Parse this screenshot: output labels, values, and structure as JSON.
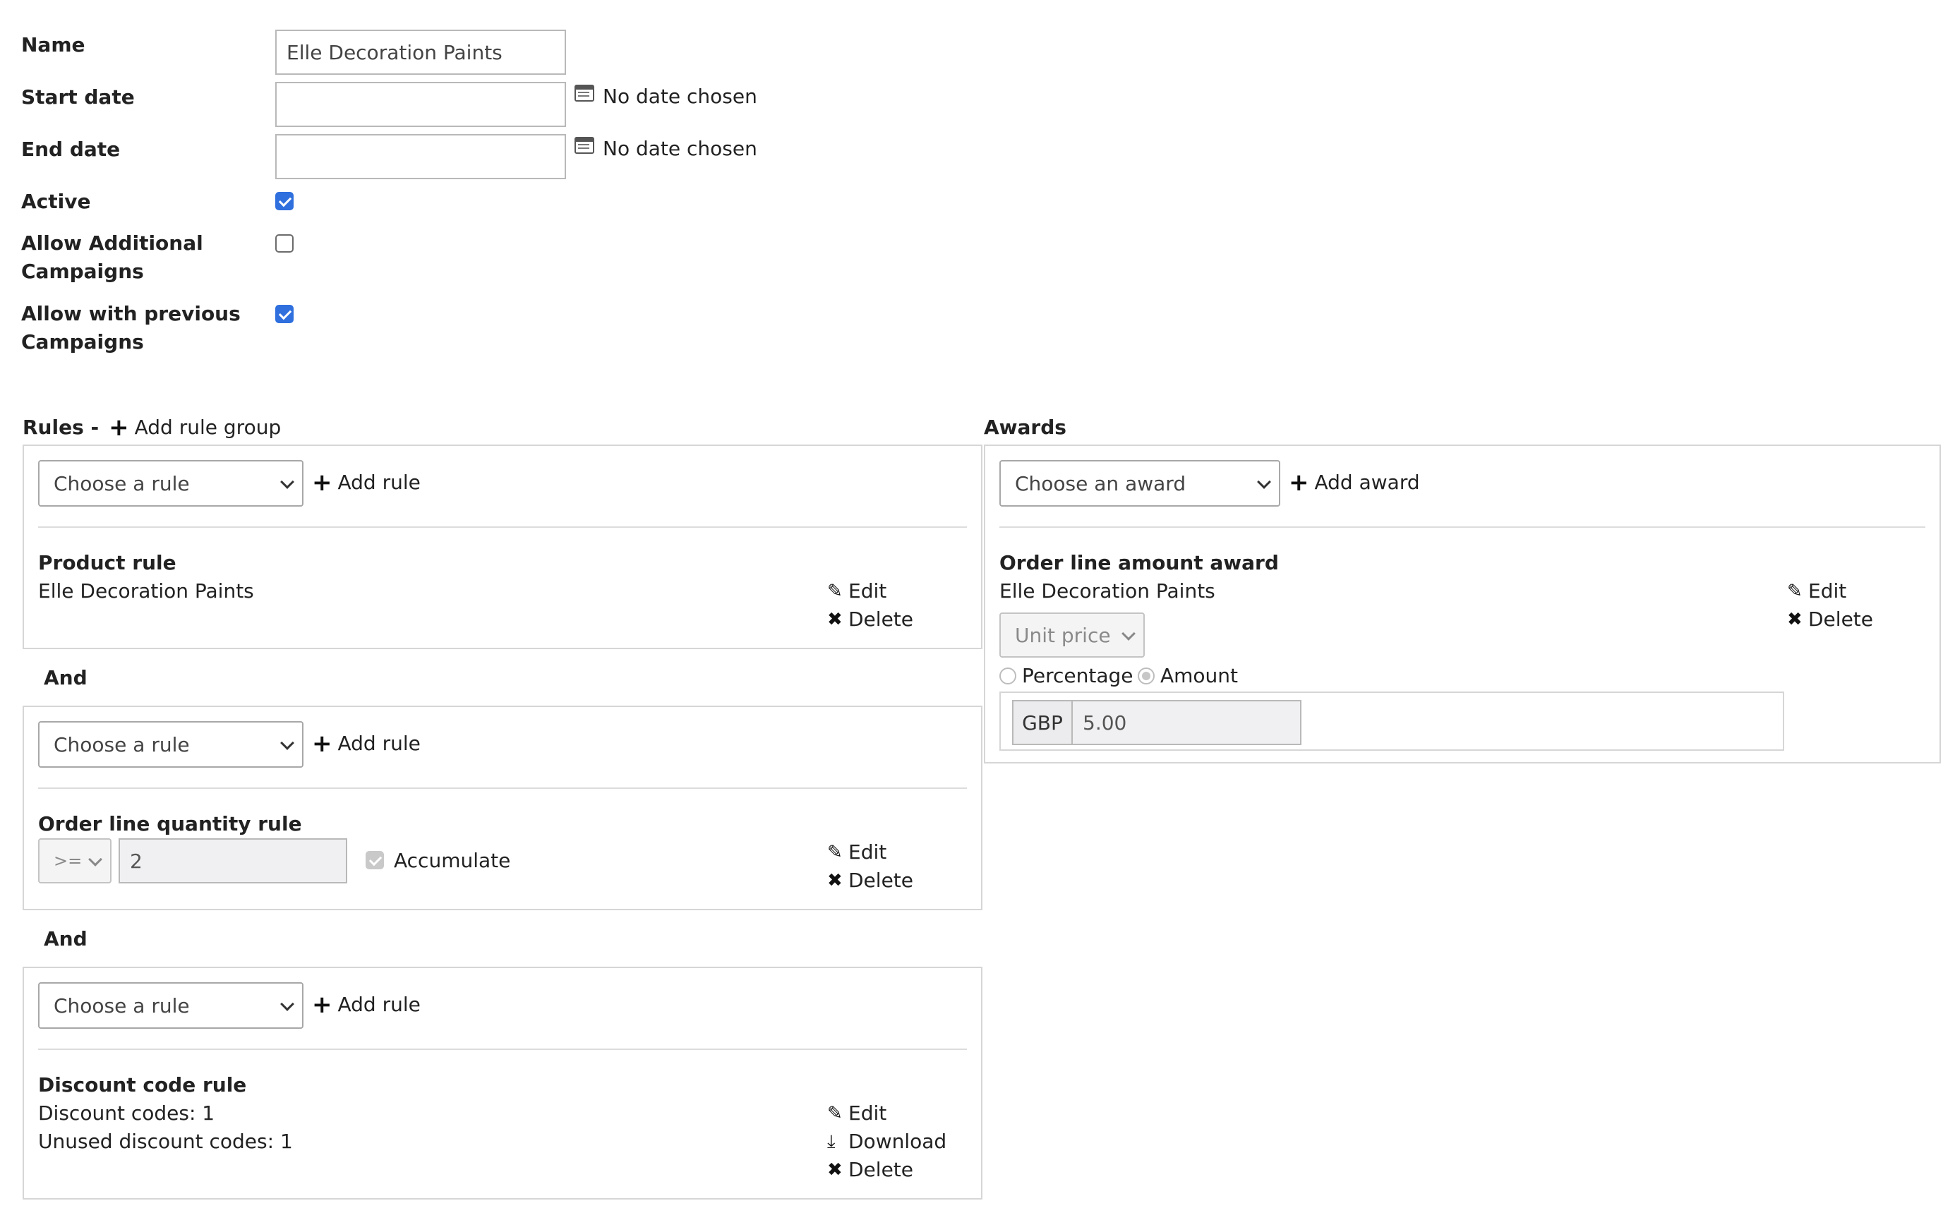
{
  "form": {
    "name_label": "Name",
    "name_value": "Elle Decoration Paints",
    "start_label": "Start date",
    "start_status": "No date chosen",
    "end_label": "End date",
    "end_status": "No date chosen",
    "active_label": "Active",
    "active_checked": true,
    "additional_label_1": "Allow Additional",
    "additional_label_2": "Campaigns",
    "additional_checked": false,
    "previous_label_1": "Allow with previous",
    "previous_label_2": "Campaigns",
    "previous_checked": true
  },
  "rules": {
    "heading": "Rules -",
    "add_group": "Add rule group",
    "and_label": "And",
    "groups": [
      {
        "select_placeholder": "Choose a rule",
        "add_label": "Add rule",
        "rule_title": "Product rule",
        "line1": "Elle Decoration Paints",
        "edit": "Edit",
        "delete": "Delete"
      },
      {
        "select_placeholder": "Choose a rule",
        "add_label": "Add rule",
        "rule_title": "Order line quantity rule",
        "operator": ">=",
        "quantity": "2",
        "accumulate_label": "Accumulate",
        "accumulate_checked": true,
        "edit": "Edit",
        "delete": "Delete"
      },
      {
        "select_placeholder": "Choose a rule",
        "add_label": "Add rule",
        "rule_title": "Discount code rule",
        "line1": "Discount codes: 1",
        "line2": "Unused discount codes: 1",
        "edit": "Edit",
        "download": "Download",
        "delete": "Delete"
      }
    ]
  },
  "awards": {
    "heading": "Awards",
    "select_placeholder": "Choose an award",
    "add_label": "Add award",
    "award_title": "Order line amount award",
    "line1": "Elle Decoration Paints",
    "price_select": "Unit price",
    "percentage_label": "Percentage",
    "amount_label": "Amount",
    "selected_mode": "Amount",
    "currency": "GBP",
    "amount": "5.00",
    "edit": "Edit",
    "delete": "Delete"
  },
  "icons": {
    "plus": "+",
    "edit": "✎",
    "delete": "✖",
    "download": "⤓"
  }
}
